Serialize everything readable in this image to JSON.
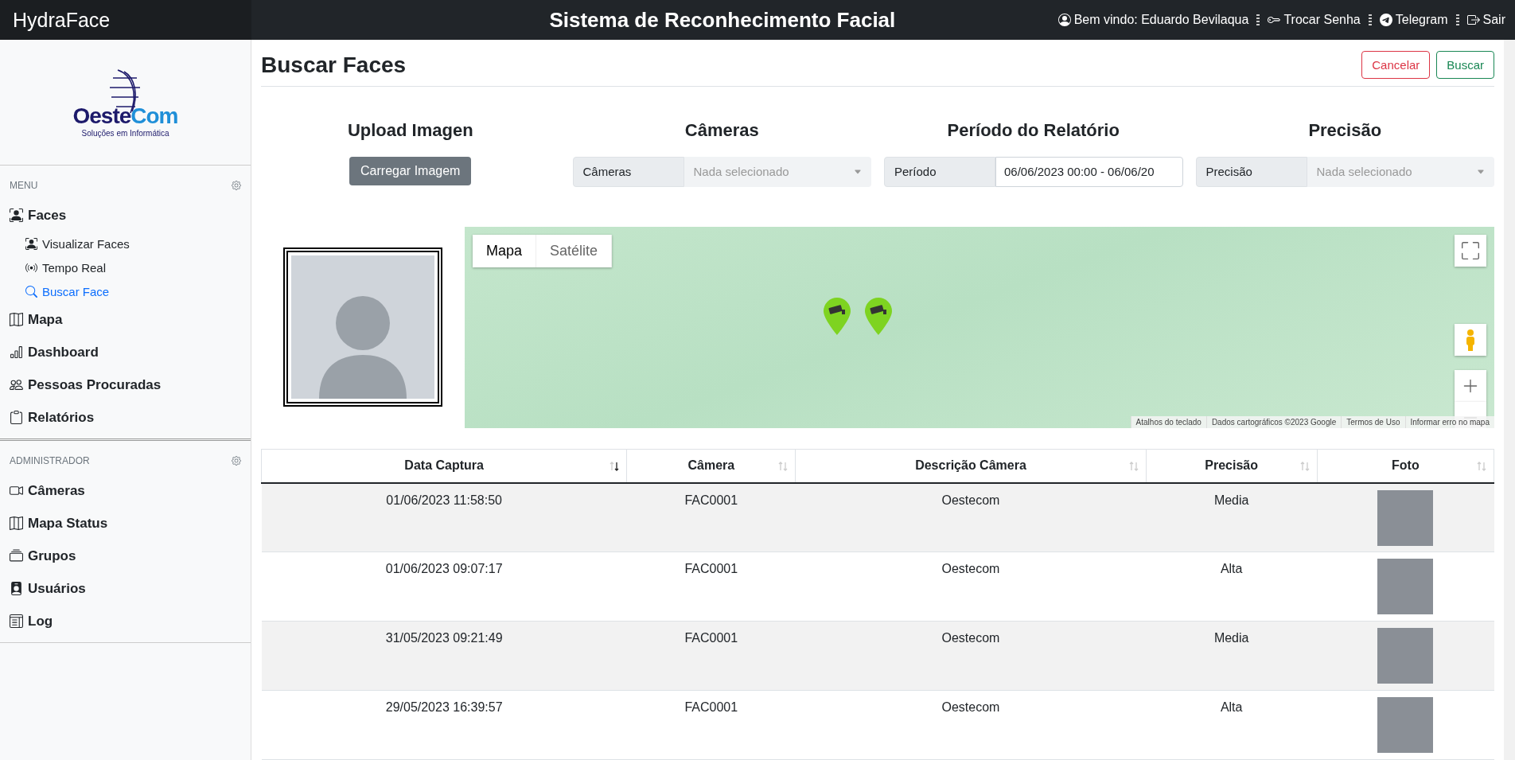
{
  "header": {
    "brand": "HydraFace",
    "title": "Sistema de Reconhecimento Facial",
    "links": [
      {
        "label": "Bem vindo: Eduardo Bevilaqua"
      },
      {
        "label": "Trocar Senha"
      },
      {
        "label": "Telegram"
      },
      {
        "label": "Sair"
      }
    ]
  },
  "sidebar": {
    "logo": {
      "part_1": "Oeste",
      "part_2": "Com",
      "tagline": "Soluções em Informática"
    },
    "sections": [
      {
        "heading": "MENU",
        "items": [
          {
            "label": "Faces",
            "selected": false,
            "children": [
              {
                "label": "Visualizar Faces",
                "selected": false
              },
              {
                "label": "Tempo Real",
                "selected": false
              },
              {
                "label": "Buscar Face",
                "selected": true
              }
            ]
          },
          {
            "label": "Mapa",
            "selected": false
          },
          {
            "label": "Dashboard",
            "selected": false
          },
          {
            "label": "Pessoas Procuradas",
            "selected": false
          },
          {
            "label": "Relatórios",
            "selected": false
          }
        ]
      },
      {
        "heading": "ADMINISTRADOR",
        "items": [
          {
            "label": "Câmeras",
            "selected": false
          },
          {
            "label": "Mapa Status",
            "selected": false
          },
          {
            "label": "Grupos",
            "selected": false
          },
          {
            "label": "Usuários",
            "selected": false
          },
          {
            "label": "Log",
            "selected": false
          }
        ]
      }
    ]
  },
  "page": {
    "title": "Buscar Faces",
    "buttons": [
      {
        "label": "Cancelar",
        "kind": "danger"
      },
      {
        "label": "Buscar",
        "kind": "success"
      }
    ]
  },
  "filters": [
    {
      "kind": "upload",
      "heading": "Upload Imagen",
      "button": "Carregar Imagem"
    },
    {
      "kind": "select",
      "heading": "Câmeras",
      "addon": "Câmeras",
      "placeholder": "Nada selecionado"
    },
    {
      "kind": "input",
      "heading": "Período do Relatório",
      "addon": "Período",
      "value": "06/06/2023 00:00 - 06/06/20"
    },
    {
      "kind": "select",
      "heading": "Precisão",
      "addon": "Precisão",
      "placeholder": "Nada selecionado"
    }
  ],
  "map": {
    "map_types": [
      {
        "label": "Mapa",
        "selected": true
      },
      {
        "label": "Satélite",
        "selected": false
      }
    ],
    "attribution": [
      "Atalhos do teclado",
      "Dados cartográficos ©2023 Google",
      "Termos de Uso",
      "Informar erro no mapa"
    ]
  },
  "table": {
    "columns": [
      {
        "label": "Data Captura",
        "sorted": true
      },
      {
        "label": "Câmera",
        "sorted": false
      },
      {
        "label": "Descrição Câmera",
        "sorted": false
      },
      {
        "label": "Precisão",
        "sorted": false
      },
      {
        "label": "Foto",
        "sorted": false
      }
    ],
    "rows": [
      [
        "01/06/2023 11:58:50",
        "FAC0001",
        "Oestecom",
        "Media"
      ],
      [
        "01/06/2023 09:07:17",
        "FAC0001",
        "Oestecom",
        "Alta"
      ],
      [
        "31/05/2023 09:21:49",
        "FAC0001",
        "Oestecom",
        "Media"
      ],
      [
        "29/05/2023 16:39:57",
        "FAC0001",
        "Oestecom",
        "Alta"
      ]
    ]
  }
}
